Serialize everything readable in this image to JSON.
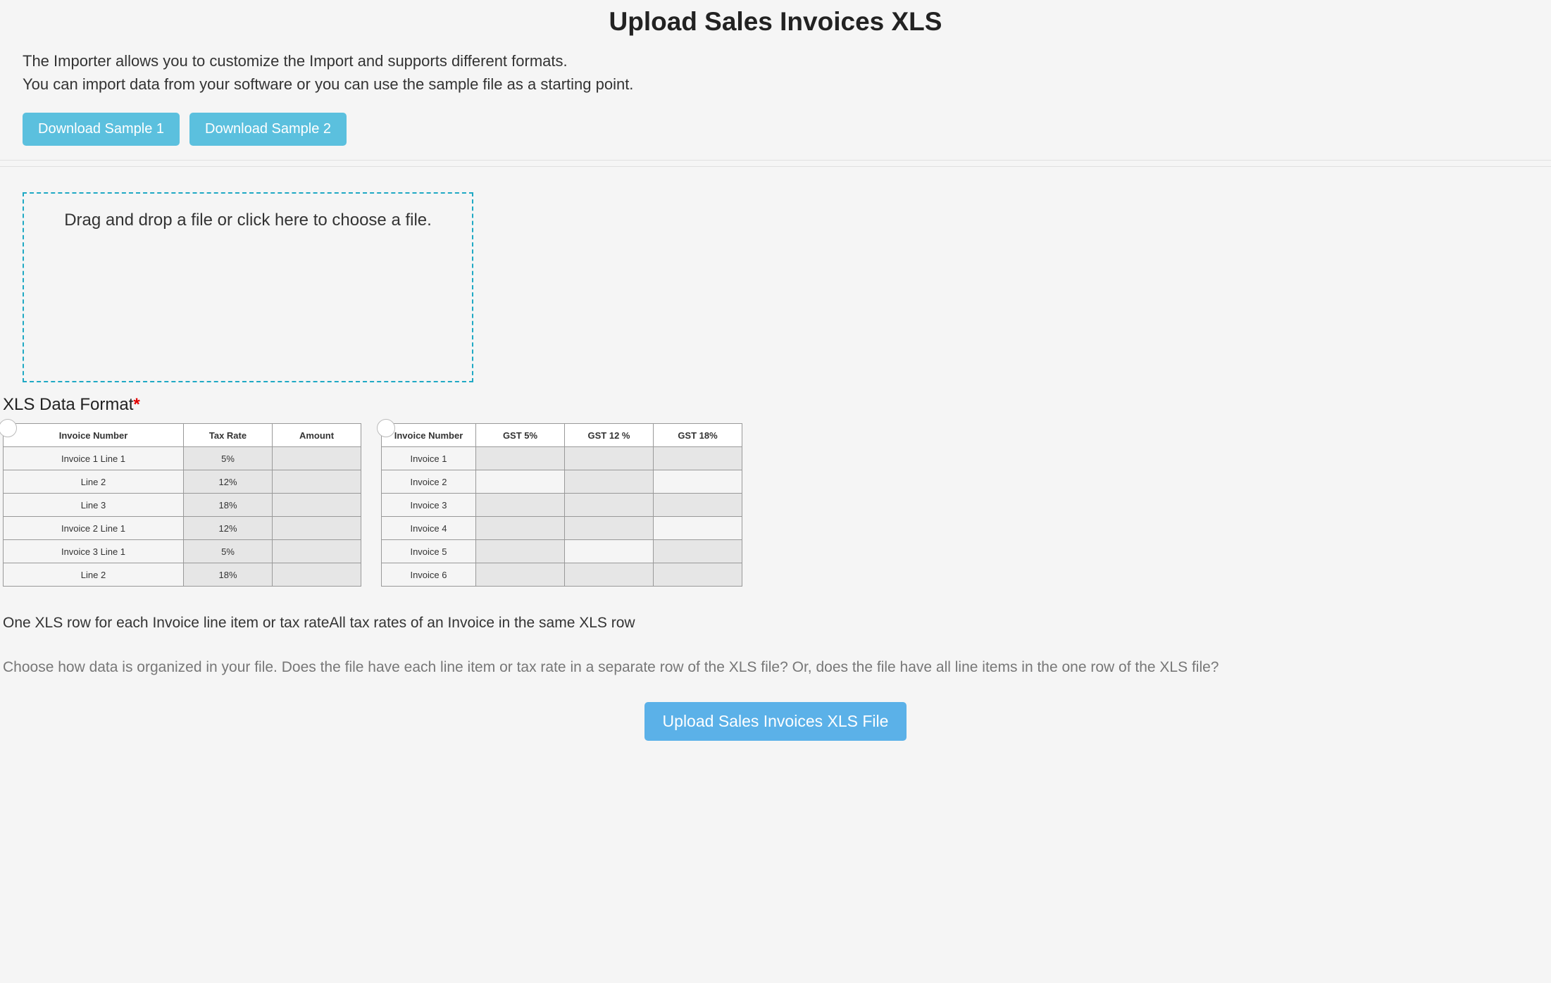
{
  "header": {
    "title": "Upload Sales Invoices XLS",
    "intro_line1": "The Importer allows you to customize the Import and supports different formats.",
    "intro_line2": "You can import data from your software or you can use the sample file as a starting point.",
    "download1_label": "Download Sample 1",
    "download2_label": "Download Sample 2"
  },
  "dropzone": {
    "text": "Drag and drop a file or click here to choose a file."
  },
  "format": {
    "label": "XLS Data Format",
    "required_star": "*",
    "table1": {
      "headers": [
        "Invoice Number",
        "Tax Rate",
        "Amount"
      ],
      "rows": [
        {
          "c1": "Invoice 1 Line 1",
          "c2": "5%"
        },
        {
          "c1": "Line 2",
          "c2": "12%"
        },
        {
          "c1": "Line 3",
          "c2": "18%"
        },
        {
          "c1": "Invoice 2 Line 1",
          "c2": "12%"
        },
        {
          "c1": "Invoice 3 Line 1",
          "c2": "5%"
        },
        {
          "c1": "Line 2",
          "c2": "18%"
        }
      ]
    },
    "table2": {
      "headers": [
        "Invoice Number",
        "GST 5%",
        "GST 12 %",
        "GST 18%"
      ],
      "rows": [
        {
          "c1": "Invoice 1"
        },
        {
          "c1": "Invoice 2"
        },
        {
          "c1": "Invoice 3"
        },
        {
          "c1": "Invoice 4"
        },
        {
          "c1": "Invoice 5"
        },
        {
          "c1": "Invoice 6"
        }
      ]
    },
    "desc1": "One XLS row for each Invoice line item or tax rate",
    "desc2": "All tax rates of an Invoice in the same XLS row",
    "help": "Choose how data is organized in your file. Does the file have each line item or tax rate in a separate row of the XLS file? Or, does the file have all line items in the one row of the XLS file?"
  },
  "upload_button_label": "Upload Sales Invoices XLS File"
}
